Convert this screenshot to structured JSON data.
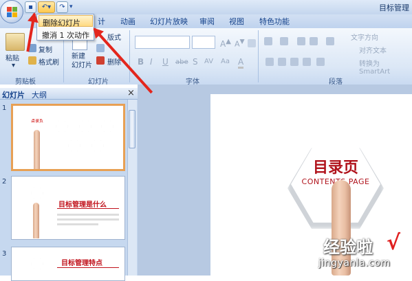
{
  "window": {
    "title": "目标管理"
  },
  "quick_access": {
    "save_icon": "save-icon",
    "undo_icon": "undo-icon",
    "redo_icon": "redo-icon",
    "customize_icon": "dropdown-icon"
  },
  "undo_menu": {
    "items": [
      "删除幻灯片",
      "撤消 1 次动作"
    ]
  },
  "tabs": [
    "计",
    "动画",
    "幻灯片放映",
    "审阅",
    "视图",
    "特色功能"
  ],
  "ribbon": {
    "clipboard": {
      "label": "剪贴板",
      "paste": "粘贴",
      "copy": "复制",
      "format_painter": "格式刷"
    },
    "slides": {
      "label": "幻灯片",
      "new_slide": "新建\n幻灯片",
      "layout": "版式",
      "delete": "删除"
    },
    "font": {
      "label": "字体",
      "bold": "B",
      "italic": "I",
      "underline": "U",
      "strike": "abe",
      "shadow": "S",
      "spacing": "AV",
      "case": "Aa",
      "color": "A"
    },
    "paragraph": {
      "label": "段落",
      "text_direction": "文字方向",
      "align_text": "对齐文本",
      "convert_smartart": "转换为 SmartArt"
    }
  },
  "panel": {
    "tab_slides": "幻灯片",
    "tab_outline": "大纲",
    "close": "×"
  },
  "thumbnails": [
    {
      "num": "1",
      "title": "目录页"
    },
    {
      "num": "2",
      "title": "目标管理是什么"
    },
    {
      "num": "3",
      "title": "目标管理特点"
    }
  ],
  "slide": {
    "title": "目录页",
    "subtitle": "CONTENTS PAGE"
  },
  "watermark": {
    "text": "经验啦",
    "check": "√",
    "url": "jingyanla.com"
  },
  "colors": {
    "accent_red": "#b0121b",
    "arrow_red": "#e3261d",
    "ribbon_blue": "#dbe7f6"
  }
}
